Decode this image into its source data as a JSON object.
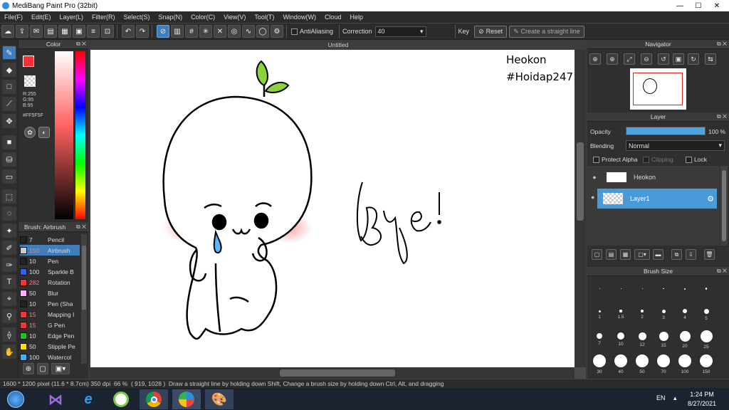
{
  "window": {
    "title": "MediBang Paint Pro (32bit)",
    "minimize": "—",
    "maximize": "☐",
    "close": "✕"
  },
  "menu": [
    "File(F)",
    "Edit(E)",
    "Layer(L)",
    "Filter(R)",
    "Select(S)",
    "Snap(N)",
    "Color(C)",
    "View(V)",
    "Tool(T)",
    "Window(W)",
    "Cloud",
    "Help"
  ],
  "toolbar": {
    "antialiasing_label": "AntiAliasing",
    "correction_label": "Correction",
    "correction_value": "40",
    "key_label": "Key",
    "reset_label": "Reset",
    "straight_line_label": "Create a straight line"
  },
  "color_panel": {
    "title": "Color",
    "r": "R:255",
    "g": "G:95",
    "b": "B:95",
    "hex": "#FF5F5F",
    "primary_color": "#ff2f2f",
    "secondary_color": "#000000"
  },
  "brush_panel": {
    "title": "Brush: Airbrush",
    "brushes": [
      {
        "size": "7",
        "name": "Pencil",
        "color": "#222222"
      },
      {
        "size": "150",
        "name": "Airbrush",
        "color": "#cccccc"
      },
      {
        "size": "10",
        "name": "Pen",
        "color": "#222222"
      },
      {
        "size": "100",
        "name": "Sparkle B",
        "color": "#3a5cff"
      },
      {
        "size": "282",
        "name": "Rotation",
        "color": "#ff3030"
      },
      {
        "size": "50",
        "name": "Blur",
        "color": "#ffb0ff"
      },
      {
        "size": "10",
        "name": "Pen (Sha",
        "color": "#222222"
      },
      {
        "size": "15",
        "name": "Mapping I",
        "color": "#ff3030"
      },
      {
        "size": "15",
        "name": "G Pen",
        "color": "#ff3030"
      },
      {
        "size": "10",
        "name": "Edge Pen",
        "color": "#20c020"
      },
      {
        "size": "50",
        "name": "Stipple Pe",
        "color": "#ffe000"
      },
      {
        "size": "100",
        "name": "Watercol",
        "color": "#40b0ff"
      }
    ]
  },
  "document": {
    "tab": "Untitled",
    "text_line1": "Heokon",
    "text_line2": "#Hoidap247",
    "bye_text": "Bye!"
  },
  "navigator": {
    "title": "Navigator"
  },
  "layer_panel": {
    "title": "Layer",
    "opacity_label": "Opacity",
    "opacity_value": "100 %",
    "opacity_fraction": 1.0,
    "blending_label": "Blending",
    "blending_value": "Normal",
    "protect_alpha": "Protect Alpha",
    "clipping": "Clipping",
    "lock": "Lock",
    "layers": [
      {
        "name": "Heokon",
        "selected": false
      },
      {
        "name": "Layer1",
        "selected": true
      }
    ]
  },
  "brush_size_panel": {
    "title": "Brush Size",
    "sizes": [
      "·",
      "·",
      "·",
      "·",
      "·",
      "·",
      "1",
      "1.5",
      "2",
      "3",
      "4",
      "5",
      "7",
      "10",
      "12",
      "15",
      "20",
      "25",
      "30",
      "40",
      "50",
      "70",
      "100",
      "150"
    ]
  },
  "status": {
    "dimensions": "1600 * 1200 pixel",
    "physical": "(11.6 * 8.7cm)",
    "dpi": "350 dpi",
    "zoom": "66 %",
    "coords": "( 919, 1028 )",
    "hint": "Draw a straight line by holding down Shift, Change a brush size by holding down Ctrl, Alt, and dragging"
  },
  "taskbar": {
    "language": "EN",
    "time": "1:24 PM",
    "date": "8/27/2021"
  }
}
